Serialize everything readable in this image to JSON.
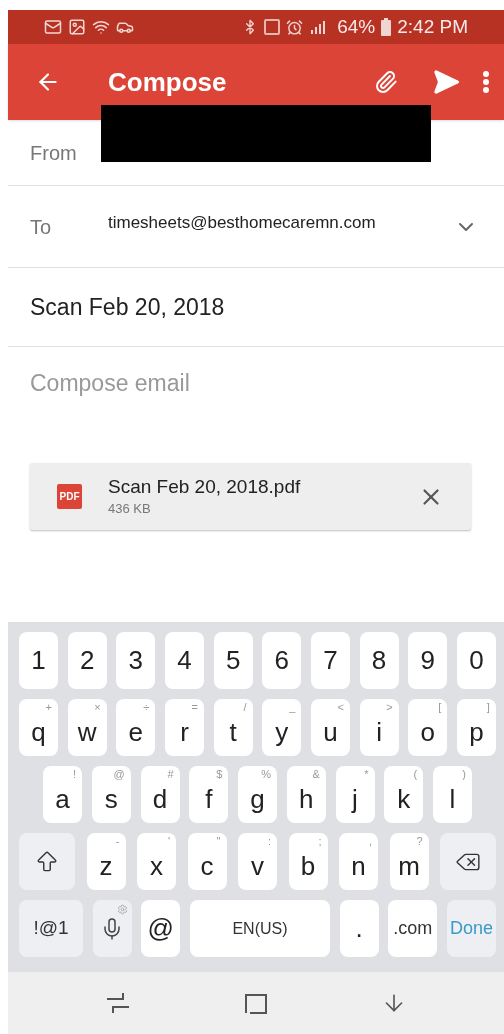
{
  "status_bar": {
    "battery": "64%",
    "time": "2:42 PM"
  },
  "app_bar": {
    "title": "Compose"
  },
  "from": {
    "label": "From"
  },
  "to": {
    "label": "To",
    "value": "timesheets@besthomecaremn.com"
  },
  "subject": {
    "value": "Scan Feb 20, 2018"
  },
  "body": {
    "placeholder": "Compose email"
  },
  "attachment": {
    "type_label": "PDF",
    "name": "Scan Feb 20, 2018.pdf",
    "size": "436 KB"
  },
  "keyboard": {
    "number_row": [
      {
        "kind": "char",
        "label": "1"
      },
      {
        "kind": "char",
        "label": "2"
      },
      {
        "kind": "char",
        "label": "3"
      },
      {
        "kind": "char",
        "label": "4"
      },
      {
        "kind": "char",
        "label": "5"
      },
      {
        "kind": "char",
        "label": "6"
      },
      {
        "kind": "char",
        "label": "7"
      },
      {
        "kind": "char",
        "label": "8"
      },
      {
        "kind": "char",
        "label": "9"
      },
      {
        "kind": "char",
        "label": "0"
      }
    ],
    "top_row": [
      {
        "kind": "char",
        "label": "q",
        "hint": "+"
      },
      {
        "kind": "char",
        "label": "w",
        "hint": "×"
      },
      {
        "kind": "char",
        "label": "e",
        "hint": "÷"
      },
      {
        "kind": "char",
        "label": "r",
        "hint": "="
      },
      {
        "kind": "char",
        "label": "t",
        "hint": "/"
      },
      {
        "kind": "char",
        "label": "y",
        "hint": "_"
      },
      {
        "kind": "char",
        "label": "u",
        "hint": "<"
      },
      {
        "kind": "char",
        "label": "i",
        "hint": ">"
      },
      {
        "kind": "char",
        "label": "o",
        "hint": "["
      },
      {
        "kind": "char",
        "label": "p",
        "hint": "]"
      }
    ],
    "home_row": [
      {
        "kind": "char",
        "label": "a",
        "hint": "!"
      },
      {
        "kind": "char",
        "label": "s",
        "hint": "@"
      },
      {
        "kind": "char",
        "label": "d",
        "hint": "#"
      },
      {
        "kind": "char",
        "label": "f",
        "hint": "$"
      },
      {
        "kind": "char",
        "label": "g",
        "hint": "%"
      },
      {
        "kind": "char",
        "label": "h",
        "hint": "&"
      },
      {
        "kind": "char",
        "label": "j",
        "hint": "*"
      },
      {
        "kind": "char",
        "label": "k",
        "hint": "("
      },
      {
        "kind": "char",
        "label": "l",
        "hint": ")"
      }
    ],
    "bottom_row": [
      {
        "kind": "shift"
      },
      {
        "kind": "char",
        "label": "z",
        "hint": "-"
      },
      {
        "kind": "char",
        "label": "x",
        "hint": "'"
      },
      {
        "kind": "char",
        "label": "c",
        "hint": "\""
      },
      {
        "kind": "char",
        "label": "v",
        "hint": ":"
      },
      {
        "kind": "char",
        "label": "b",
        "hint": ";"
      },
      {
        "kind": "char",
        "label": "n",
        "hint": ","
      },
      {
        "kind": "char",
        "label": "m",
        "hint": "?"
      },
      {
        "kind": "backspace"
      }
    ],
    "function_row": [
      {
        "kind": "symbols",
        "label": "!@1"
      },
      {
        "kind": "mic"
      },
      {
        "kind": "char",
        "label": "@"
      },
      {
        "kind": "space",
        "label": "EN(US)"
      },
      {
        "kind": "char",
        "label": "."
      },
      {
        "kind": "wide",
        "label": ".com"
      },
      {
        "kind": "done",
        "label": "Done"
      }
    ]
  }
}
